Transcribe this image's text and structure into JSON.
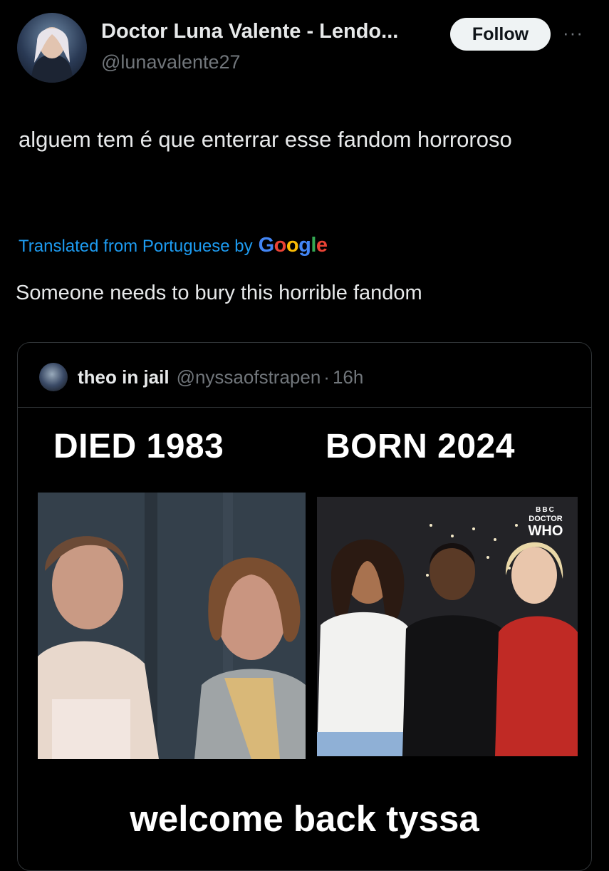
{
  "author": {
    "display_name": "Doctor Luna Valente - Lendo...",
    "handle": "@lunavalente27"
  },
  "actions": {
    "follow_label": "Follow",
    "more_label": "···"
  },
  "tweet": {
    "text": "alguem tem é que enterrar esse fandom horroroso",
    "translated_label": "Translated from Portuguese by",
    "translated_provider": "Google",
    "translation": "Someone needs to bury this horrible fandom"
  },
  "quoted_tweet": {
    "display_name": "theo in jail",
    "handle": "@nyssaofstrapen",
    "separator": "·",
    "time": "16h",
    "meme": {
      "left_caption": "DIED 1983",
      "right_caption": "BORN 2024",
      "bottom_caption": "welcome back tyssa",
      "logo_bbc": "BBC",
      "logo_doctor": "DOCTOR",
      "logo_who": "WHO"
    }
  },
  "colors": {
    "background": "#000000",
    "text_primary": "#e7e9ea",
    "text_secondary": "#71767b",
    "link": "#1d9bf0",
    "border": "#2f3336"
  },
  "icons": {
    "more": "more-horizontal-icon"
  }
}
